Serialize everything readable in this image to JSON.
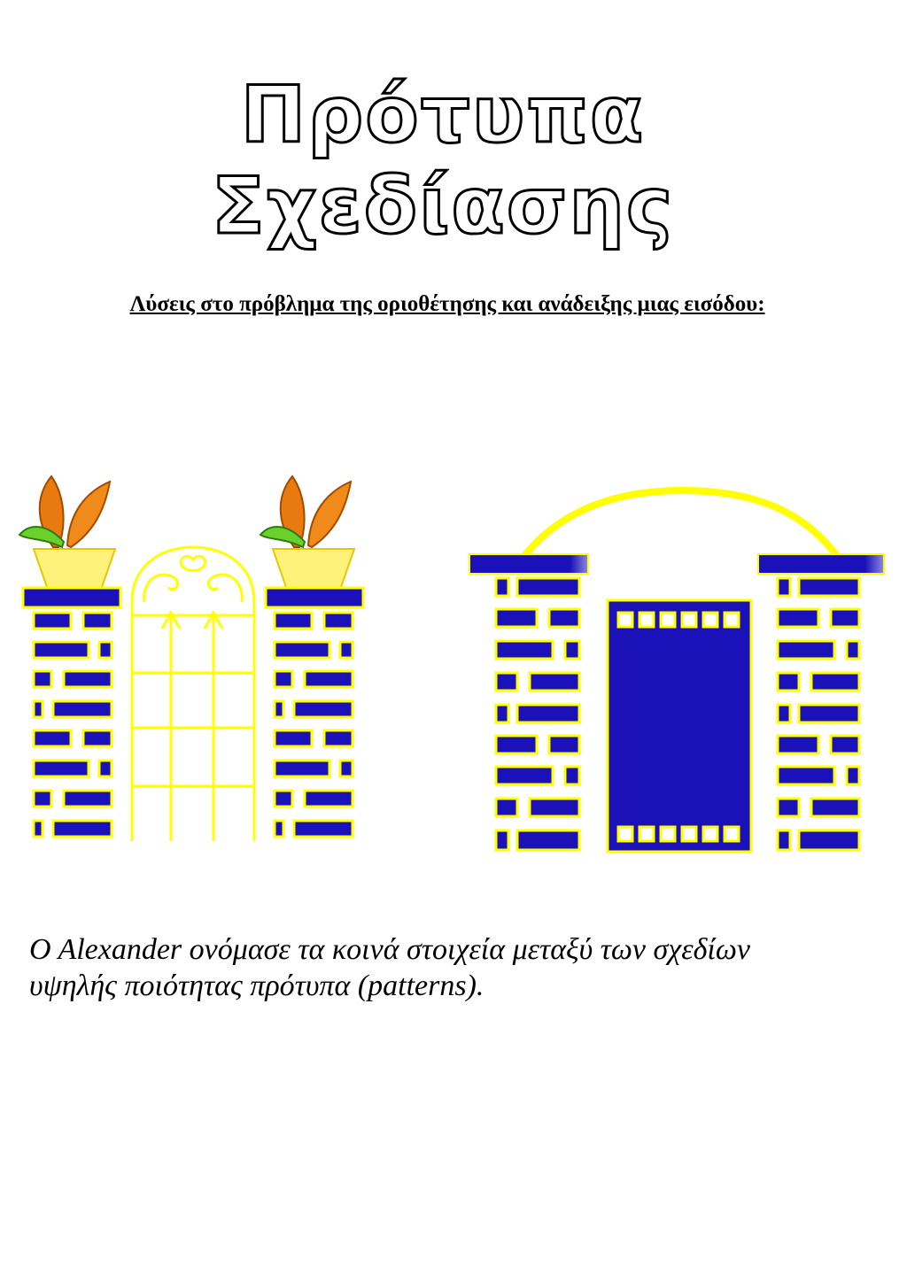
{
  "document": {
    "title": "Πρότυπα Σχεδίασης",
    "subtitle": "Λύσεις στο πρόβλημα της οριοθέτησης και ανάδειξης μιας εισόδου:",
    "body_lines": [
      "O Alexander ονόμασε τα κοινά στοιχεία μεταξύ των σχεδίων",
      "υψηλής ποιότητας πρότυπα (patterns)."
    ]
  },
  "colors": {
    "brick": "#1a12b8",
    "mortar": "#ffff00",
    "leaf_orange": "#e87a10",
    "leaf_green": "#6ad02a",
    "pot": "#fff27a"
  }
}
